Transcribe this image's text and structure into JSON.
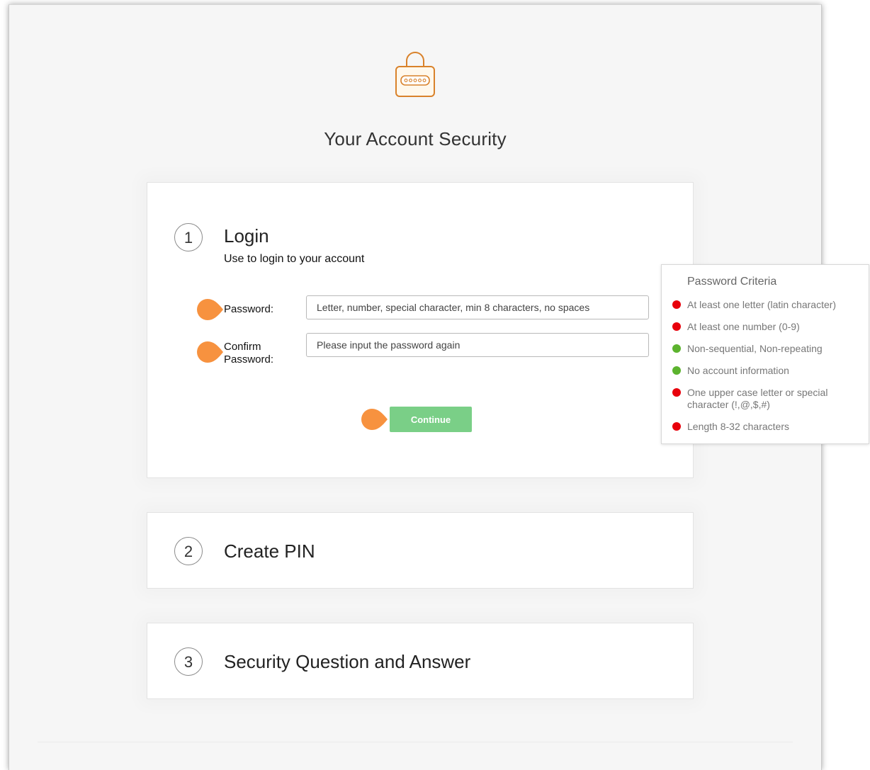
{
  "page": {
    "title": "Your Account Security"
  },
  "login": {
    "step": "1",
    "title": "Login",
    "subtitle": "Use to login to your account",
    "password_label": "Password:",
    "password_placeholder": "Letter, number, special character, min 8 characters, no spaces",
    "confirm_label_line1": "Confirm",
    "confirm_label_line2": "Password:",
    "confirm_placeholder": "Please input the password again",
    "continue_label": "Continue"
  },
  "pin": {
    "step": "2",
    "title": "Create PIN"
  },
  "security": {
    "step": "3",
    "title": "Security Question and Answer"
  },
  "criteria": {
    "title": "Password Criteria",
    "items": [
      {
        "text": "At least one letter (latin character)",
        "status": "fail"
      },
      {
        "text": "At least one number (0-9)",
        "status": "fail"
      },
      {
        "text": "Non-sequential, Non-repeating",
        "status": "pass"
      },
      {
        "text": "No account information",
        "status": "pass"
      },
      {
        "text": "One upper case letter or special character (!,@,$,#)",
        "status": "fail"
      },
      {
        "text": "Length 8-32 characters",
        "status": "fail"
      }
    ]
  },
  "colors": {
    "fail": "#e8000b",
    "pass": "#5cb32e",
    "accent_orange": "#f7923f",
    "icon_orange": "#d9822b",
    "continue_green": "#7acf87"
  },
  "icons": {
    "lock": "lock-icon",
    "marker": "orange-pointer-marker"
  }
}
